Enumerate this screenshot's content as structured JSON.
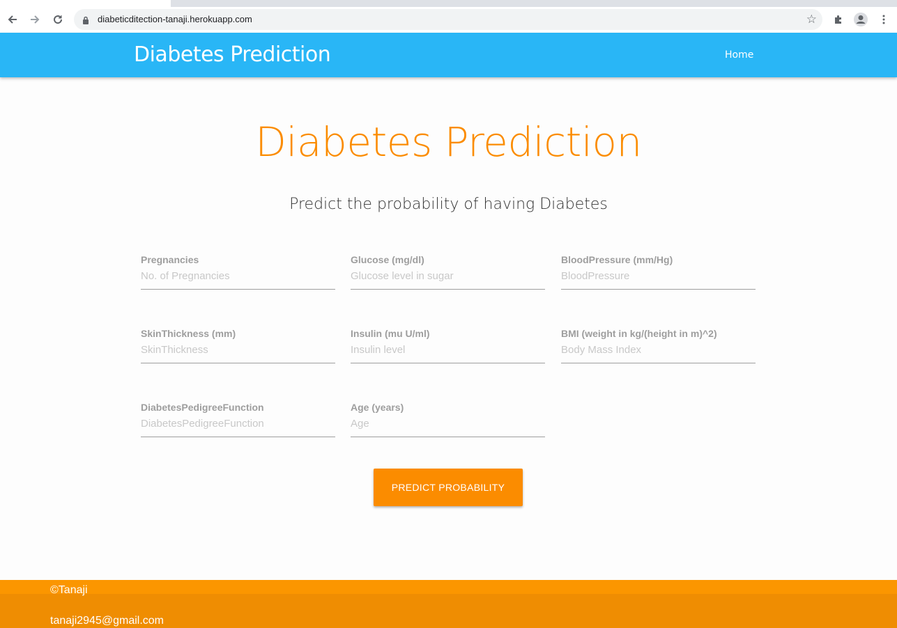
{
  "browser": {
    "url": "diabeticditection-tanaji.herokuapp.com"
  },
  "navbar": {
    "brand": "Diabetes Prediction",
    "home_link": "Home",
    "color": "#29b6f6"
  },
  "hero": {
    "title": "Diabetes Prediction",
    "subtitle": "Predict the probability of having Diabetes",
    "accent_color": "#fb8c00"
  },
  "form": {
    "fields": [
      {
        "label": "Pregnancies",
        "placeholder": "No. of Pregnancies",
        "value": ""
      },
      {
        "label": "Glucose (mg/dl)",
        "placeholder": "Glucose level in sugar",
        "value": ""
      },
      {
        "label": "BloodPressure (mm/Hg)",
        "placeholder": "BloodPressure",
        "value": ""
      },
      {
        "label": "SkinThickness (mm)",
        "placeholder": "SkinThickness",
        "value": ""
      },
      {
        "label": "Insulin (mu U/ml)",
        "placeholder": "Insulin level",
        "value": ""
      },
      {
        "label": "BMI (weight in kg/(height in m)^2)",
        "placeholder": "Body Mass Index",
        "value": ""
      },
      {
        "label": "DiabetesPedigreeFunction",
        "placeholder": "DiabetesPedigreeFunction",
        "value": ""
      },
      {
        "label": "Age (years)",
        "placeholder": "Age",
        "value": ""
      }
    ],
    "submit_label": "PREDICT PROBABILITY"
  },
  "footer": {
    "copyright": "©Tanaji",
    "email": "tanaji2945@gmail.com",
    "color": "#fb8c00"
  }
}
